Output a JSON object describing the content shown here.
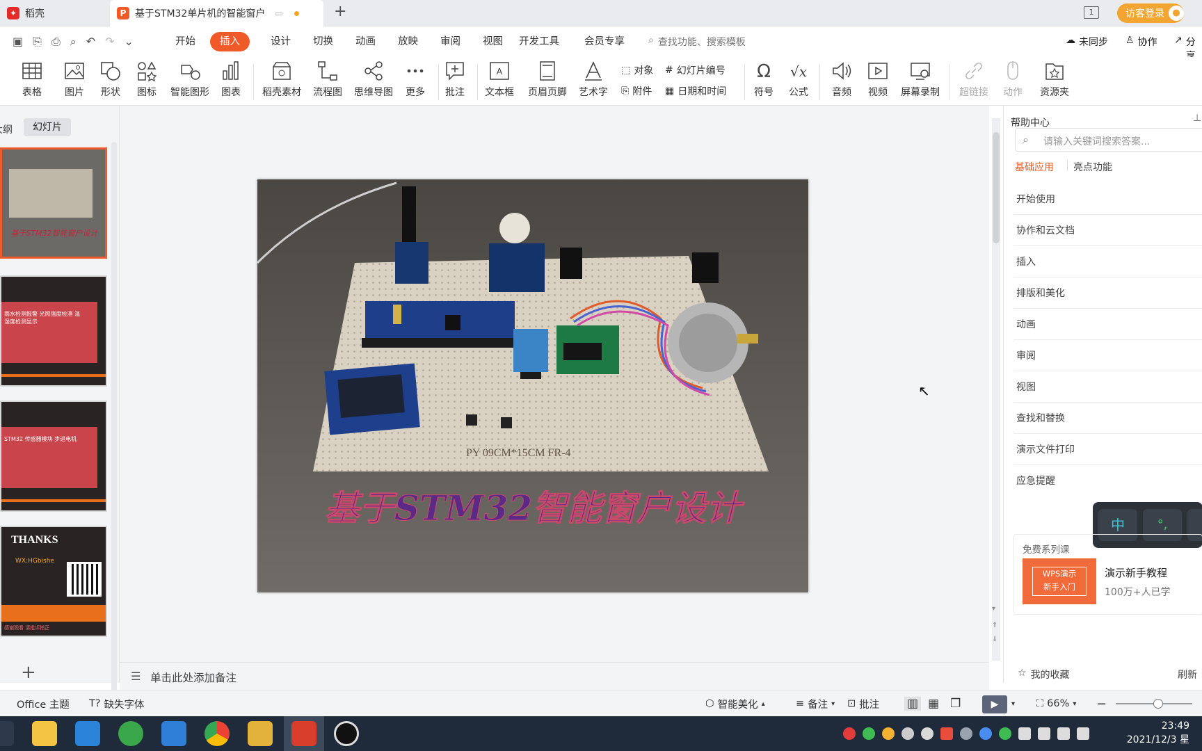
{
  "tabs": {
    "home": "稻壳",
    "doc": "基于STM32单片机的智能窗户",
    "new_tab": "+",
    "visitor": "访客登录"
  },
  "menu": {
    "items": [
      "开始",
      "插入",
      "设计",
      "切换",
      "动画",
      "放映",
      "审阅",
      "视图",
      "开发工具",
      "会员专享"
    ],
    "active": "插入",
    "search": "查找功能、搜索模板",
    "unsync": "未同步",
    "collab": "协作",
    "share": "分享"
  },
  "ribbon": {
    "big": [
      "表格",
      "图片",
      "形状",
      "图标",
      "智能图形",
      "图表",
      "稻壳素材",
      "流程图",
      "思维导图",
      "更多",
      "批注",
      "文本框",
      "页眉页脚",
      "艺术字",
      "符号",
      "公式",
      "音频",
      "视频",
      "屏幕录制",
      "超链接",
      "动作",
      "资源夹"
    ],
    "small": {
      "object": "对象",
      "slide_num": "幻灯片编号",
      "attach": "附件",
      "datetime": "日期和时间"
    }
  },
  "leftpanel": {
    "outline": "大纲",
    "slides": "幻灯片",
    "add": "+",
    "thumbs": [
      {
        "text": "基于STM32智能窗户设计"
      },
      {
        "text": "雨水检测报警 光照强度检测 温湿度检测显示"
      },
      {
        "text": "STM32 传感器模块 步进电机"
      },
      {
        "text": "THANKS",
        "sub": "WX:HGbishe",
        "footer": "感谢观看 请批评指正"
      }
    ]
  },
  "slide": {
    "title": "基于STM32智能窗户设计",
    "board_text": "PY  09CM*15CM  FR-4"
  },
  "right": {
    "help": "帮助中心",
    "search_placeholder": "请输入关键词搜索答案...",
    "tab_basic": "基础应用",
    "tab_highlight": "亮点功能",
    "items": [
      "开始使用",
      "协作和云文档",
      "插入",
      "排版和美化",
      "动画",
      "审阅",
      "视图",
      "查找和替换",
      "演示文件打印",
      "应急提醒"
    ],
    "course": {
      "label": "免费系列课",
      "thumb_line1": "WPS演示",
      "thumb_line2": "新手入门",
      "title": "演示新手教程",
      "learners": "100万+人已学"
    },
    "fav": "我的收藏",
    "refresh": "刷新",
    "ime": {
      "zh": "中",
      "punct": "°,"
    }
  },
  "notes": {
    "placeholder": "单击此处添加备注"
  },
  "status": {
    "theme": "Office 主题",
    "missing_font": "缺失字体",
    "beautify": "智能美化",
    "remarks": "备注",
    "comment": "批注",
    "zoom": "66%"
  },
  "taskbar": {
    "time": "23:49",
    "date": "2021/12/3 星"
  },
  "colors": {
    "accent": "#f05a28",
    "title_ink": "#5b2a86",
    "taskbar": "#1f2b3a"
  }
}
